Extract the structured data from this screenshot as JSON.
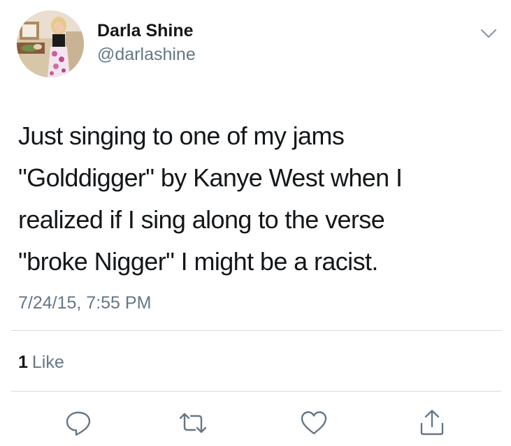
{
  "author": {
    "display_name": "Darla Shine",
    "handle": "@darlashine",
    "avatar_icon": "profile-photo"
  },
  "menu": {
    "icon": "chevron-down-icon"
  },
  "tweet": {
    "lines": [
      "Just singing to one of my jams",
      "\"Golddigger\" by Kanye West when I",
      "realized if I sing along to the verse",
      "\"broke Nigger\" I might be a racist."
    ],
    "timestamp": "7/24/15, 7:55 PM"
  },
  "stats": {
    "like_count": "1",
    "like_label": "Like"
  },
  "actions": [
    {
      "name": "reply",
      "icon": "reply-icon"
    },
    {
      "name": "retweet",
      "icon": "retweet-icon"
    },
    {
      "name": "like",
      "icon": "heart-icon"
    },
    {
      "name": "share",
      "icon": "share-icon"
    }
  ],
  "colors": {
    "primary_text": "#14171a",
    "secondary_text": "#657786",
    "divider": "#d6dbe0",
    "icon": "#657786"
  }
}
